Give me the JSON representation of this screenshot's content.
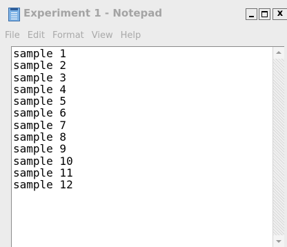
{
  "window": {
    "title": "Experiment 1 - Notepad",
    "app_icon": "notepad-icon",
    "controls": {
      "minimize_icon": "minimize-icon",
      "maximize_icon": "maximize-icon",
      "close_label": "x"
    }
  },
  "menu": {
    "items": [
      "File",
      "Edit",
      "Format",
      "View",
      "Help"
    ]
  },
  "document": {
    "lines": [
      "sample 1",
      "sample 2",
      "sample 3",
      "sample 4",
      "sample 5",
      "sample 6",
      "sample 7",
      "sample 8",
      "sample 9",
      "sample 10",
      "sample 11",
      "sample 12"
    ]
  },
  "scrollbar": {
    "up_icon": "scroll-up-arrow-icon",
    "down_icon": "scroll-down-arrow-icon"
  }
}
